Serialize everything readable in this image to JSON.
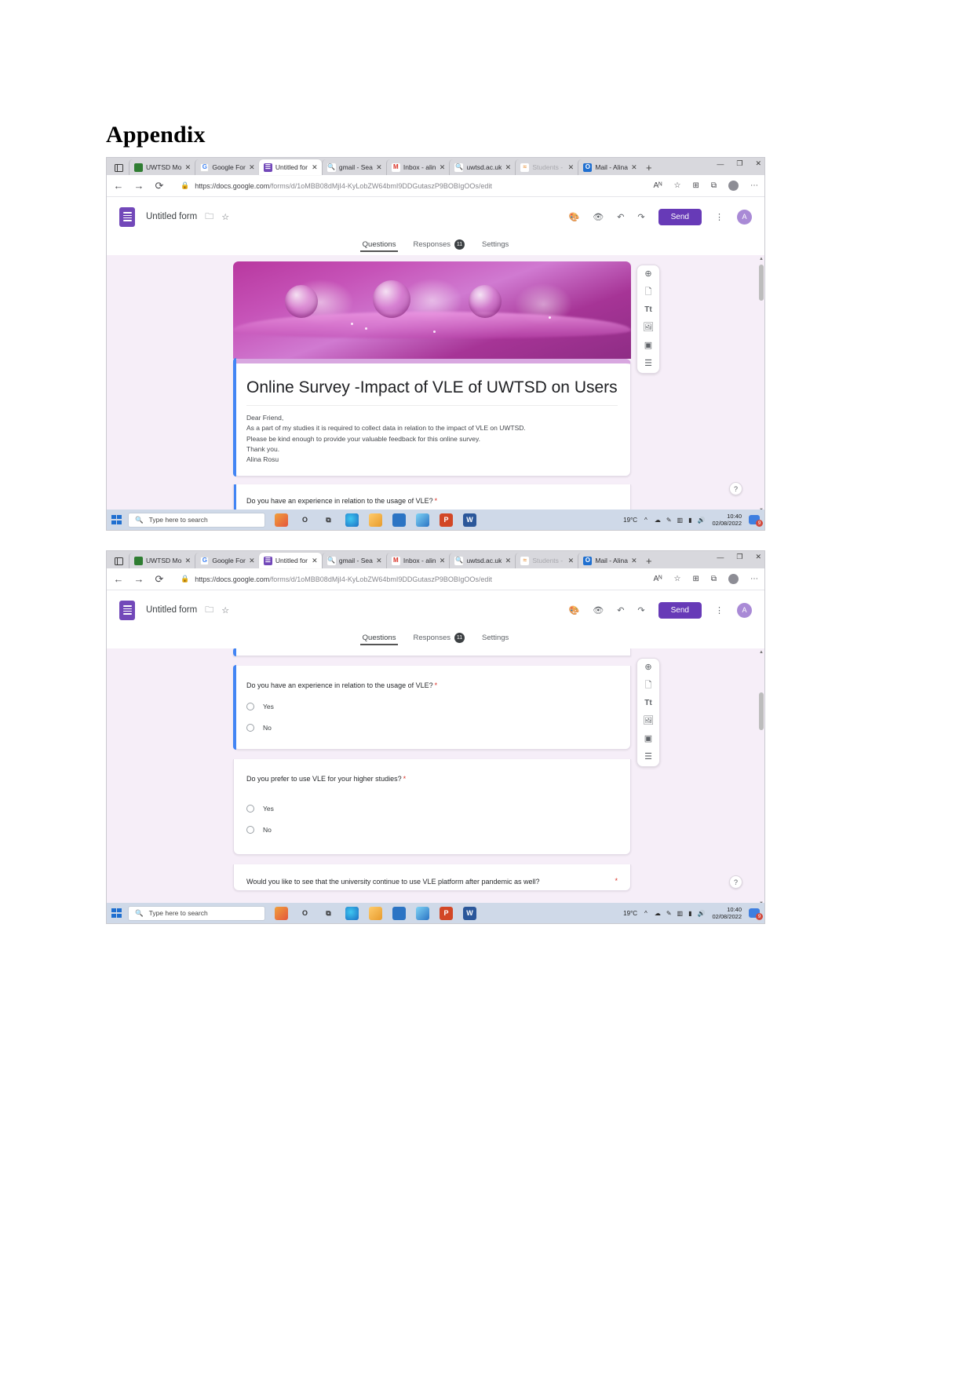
{
  "document": {
    "heading": "Appendix"
  },
  "browser": {
    "tabs": [
      {
        "label": "UWTSD Mo",
        "favicon_text": "U",
        "favicon_color": "#2f7d32",
        "active": false
      },
      {
        "label": "Google For",
        "favicon_text": "G",
        "favicon_color": "#ffffff",
        "active": false
      },
      {
        "label": "Untitled for",
        "favicon_text": "F",
        "favicon_color": "#7248b9",
        "active": true
      },
      {
        "label": "gmail - Sea",
        "favicon_text": "Q",
        "favicon_color": "#ffffff",
        "active": false
      },
      {
        "label": "Inbox - alin",
        "favicon_text": "M",
        "favicon_color": "#ffffff",
        "active": false
      },
      {
        "label": "uwtsd.ac.uk",
        "favicon_text": "Q",
        "favicon_color": "#ffffff",
        "active": false
      },
      {
        "label": "Students -",
        "favicon_text": "S",
        "favicon_color": "#ffffff",
        "active": false
      },
      {
        "label": "Mail - Alina",
        "favicon_text": "O",
        "favicon_color": "#1f6fd0",
        "active": false
      }
    ],
    "new_tab_label": "+",
    "window_controls": {
      "minimize": "—",
      "maximize": "❐",
      "close": "✕"
    },
    "nav": {
      "back": "←",
      "forward": "→",
      "reload": "⟳"
    },
    "url_prefix": "https://docs.google.com",
    "url_rest": "/forms/d/1oMBB08dMjI4-KyLobZW64bmI9DDGutaszP9BOBIgOOs/edit",
    "lock_icon": "🔒",
    "addr_icons": {
      "read_aloud": "Aᴺ",
      "favorite": "☆",
      "collections": "⧉",
      "favorites_bar": "⊞",
      "profile": "avatar",
      "settings": "⋯"
    }
  },
  "forms_app": {
    "logo_name": "google-forms-logo",
    "title": "Untitled form",
    "move_to_folder_icon": "🗀",
    "star_icon": "☆",
    "toolbar": {
      "theme_icon": "🎨",
      "preview_icon": "👁",
      "undo_icon": "↶",
      "redo_icon": "↷",
      "send_label": "Send",
      "more_icon": "⋮",
      "account_initial": "A"
    },
    "tabs": [
      {
        "label": "Questions",
        "active": true
      },
      {
        "label": "Responses",
        "active": false,
        "badge": "11"
      },
      {
        "label": "Settings",
        "active": false
      }
    ],
    "side_toolbar": [
      {
        "name": "add-question-icon",
        "glyph": "⊕"
      },
      {
        "name": "import-questions-icon",
        "glyph": "🗋"
      },
      {
        "name": "add-title-description-icon",
        "glyph": "Tt"
      },
      {
        "name": "add-image-icon",
        "glyph": "🖼"
      },
      {
        "name": "add-video-icon",
        "glyph": "▣"
      },
      {
        "name": "add-section-icon",
        "glyph": "☰"
      }
    ],
    "help_icon": "?"
  },
  "form": {
    "title": "Online Survey -Impact of VLE of UWTSD on Users",
    "description_lines": [
      "Dear Friend,",
      "As a part of my studies it is required to collect data in relation to the impact of VLE on UWTSD.",
      "Please be kind enough to provide your valuable feedback for this online survey.",
      "Thank you.",
      "Alina Rosu"
    ],
    "questions": [
      {
        "text": "Do you have an experience in relation to the usage of VLE?",
        "required_mark": "*",
        "options": [
          "Yes",
          "No"
        ]
      },
      {
        "text": "Do you prefer to use VLE for your higher studies?",
        "required_mark": "*",
        "options": [
          "Yes",
          "No"
        ]
      },
      {
        "text": "Would you like to see that the university continue to use VLE platform after pandemic as well?",
        "required_mark": "*",
        "options": []
      }
    ],
    "partial_question_top": "Do you have an experience in relation to the usage of VLE?"
  },
  "taskbar": {
    "search_placeholder": "Type here to search",
    "search_icon": "search-icon",
    "apps": [
      {
        "name": "widgets-icon",
        "text": "",
        "color": "#e8a33d"
      },
      {
        "name": "opera-icon",
        "text": "O",
        "color": "#d8443c"
      },
      {
        "name": "task-view-icon",
        "text": "⧉",
        "color": "#5a5a5a"
      },
      {
        "name": "edge-icon",
        "text": "e",
        "color": "#1f9fd0"
      },
      {
        "name": "file-explorer-icon",
        "text": "",
        "color": "#e8a33d"
      },
      {
        "name": "microsoft-store-icon",
        "text": "",
        "color": "#2b74c4"
      },
      {
        "name": "mail-icon",
        "text": "",
        "color": "#2b74c4"
      },
      {
        "name": "powerpoint-icon",
        "text": "P",
        "color": "#d24726"
      },
      {
        "name": "word-icon",
        "text": "W",
        "color": "#2b579a"
      }
    ],
    "weather": "19°C",
    "tray_chevron": "^",
    "time": "10:40",
    "date": "02/08/2022",
    "chat_badge": "9"
  }
}
